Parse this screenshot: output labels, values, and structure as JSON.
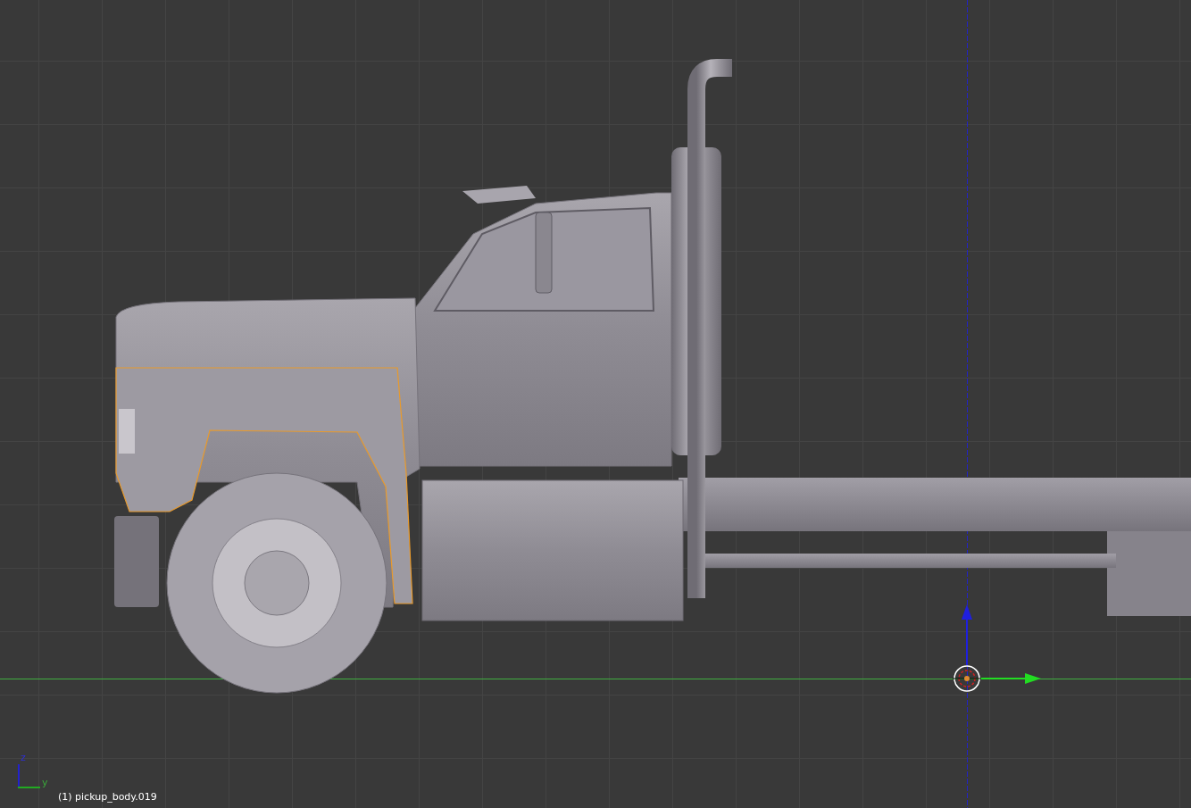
{
  "viewport": {
    "object_label": "(1) pickup_body.019",
    "axis_gizmo": {
      "vertical_label": "z",
      "horizontal_label": "y"
    }
  }
}
